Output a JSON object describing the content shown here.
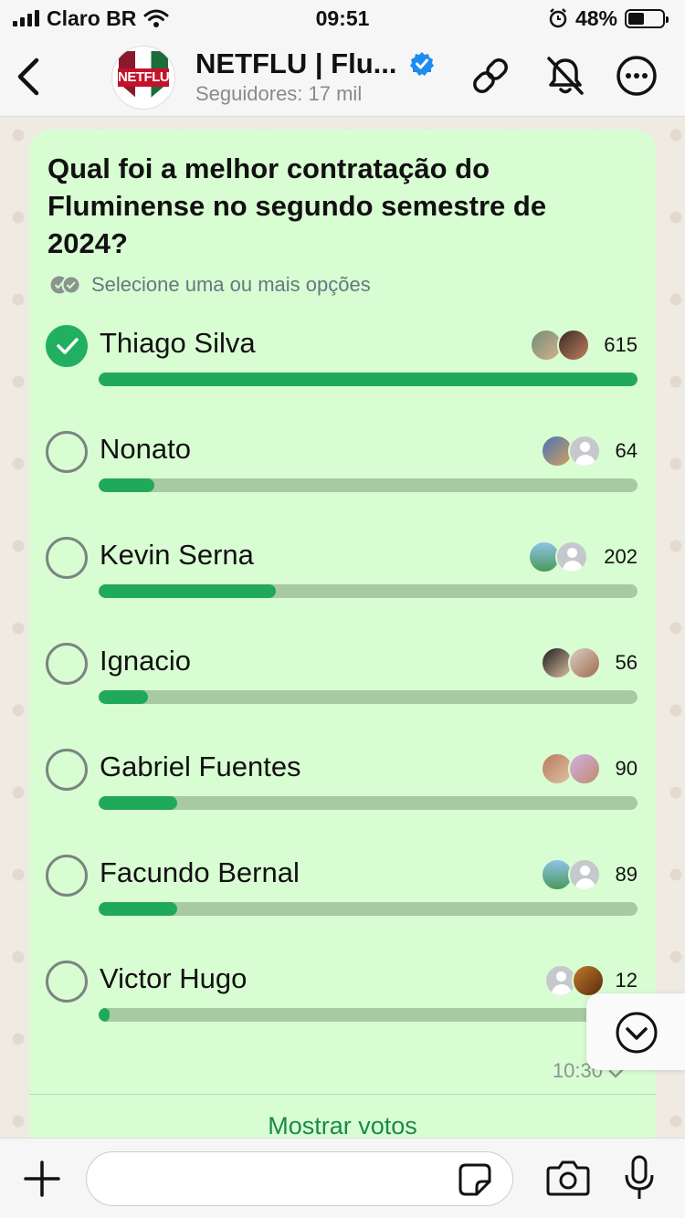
{
  "status": {
    "carrier": "Claro BR",
    "time": "09:51",
    "battery": "48%",
    "battery_level": 0.48
  },
  "header": {
    "channel_name": "NETFLU | Flu...",
    "subtitle": "Seguidores: 17 mil",
    "avatar_text": "NETFLU",
    "icons": [
      "back-icon",
      "verified-icon",
      "link-icon",
      "bell-muted-icon",
      "more-icon"
    ]
  },
  "poll": {
    "question": "Qual foi a melhor contratação do Fluminense no segundo semestre de 2024?",
    "hint": "Selecione uma ou mais opções",
    "time": "10:30",
    "show_votes": "Mostrar votos",
    "options": [
      {
        "label": "Thiago Silva",
        "votes": "615",
        "fraction": 1.0,
        "selected": true
      },
      {
        "label": "Nonato",
        "votes": "64",
        "fraction": 0.104,
        "selected": false
      },
      {
        "label": "Kevin Serna",
        "votes": "202",
        "fraction": 0.328,
        "selected": false
      },
      {
        "label": "Ignacio",
        "votes": "56",
        "fraction": 0.091,
        "selected": false
      },
      {
        "label": "Gabriel Fuentes",
        "votes": "90",
        "fraction": 0.146,
        "selected": false
      },
      {
        "label": "Facundo Bernal",
        "votes": "89",
        "fraction": 0.145,
        "selected": false
      },
      {
        "label": "Victor Hugo",
        "votes": "12",
        "fraction": 0.02,
        "selected": false
      }
    ]
  },
  "colors": {
    "bubble": "#d9fdd3",
    "accent": "#21a95a",
    "track": "#a7c9a4"
  }
}
